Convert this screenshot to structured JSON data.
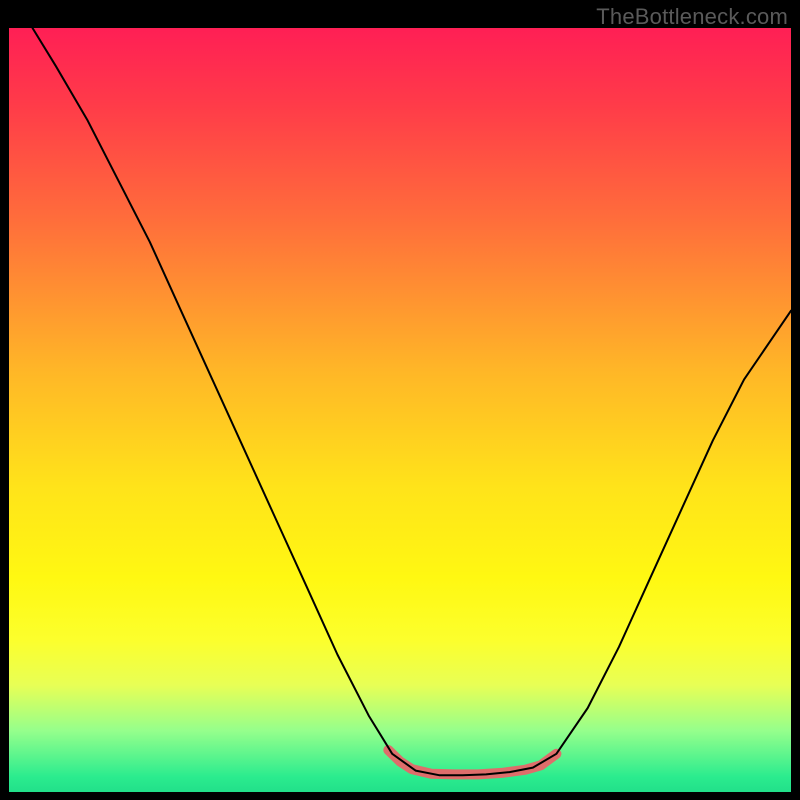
{
  "watermark": "TheBottleneck.com",
  "chart_data": {
    "type": "line",
    "title": "",
    "xlabel": "",
    "ylabel": "",
    "xlim": [
      0,
      100
    ],
    "ylim": [
      0,
      100
    ],
    "grid": false,
    "legend": false,
    "background_gradient": {
      "stops": [
        {
          "offset": 0.0,
          "color": "#ff1f55"
        },
        {
          "offset": 0.1,
          "color": "#ff3b49"
        },
        {
          "offset": 0.25,
          "color": "#ff6d3b"
        },
        {
          "offset": 0.45,
          "color": "#ffb727"
        },
        {
          "offset": 0.6,
          "color": "#ffe31a"
        },
        {
          "offset": 0.72,
          "color": "#fff812"
        },
        {
          "offset": 0.8,
          "color": "#fcff2c"
        },
        {
          "offset": 0.86,
          "color": "#e8ff55"
        },
        {
          "offset": 0.92,
          "color": "#95ff8c"
        },
        {
          "offset": 0.98,
          "color": "#2bec8e"
        },
        {
          "offset": 1.0,
          "color": "#22e08a"
        }
      ]
    },
    "curve": {
      "color": "#000000",
      "width": 2,
      "points": [
        {
          "x": 3,
          "y": 100
        },
        {
          "x": 6,
          "y": 95
        },
        {
          "x": 10,
          "y": 88
        },
        {
          "x": 14,
          "y": 80
        },
        {
          "x": 18,
          "y": 72
        },
        {
          "x": 22,
          "y": 63
        },
        {
          "x": 26,
          "y": 54
        },
        {
          "x": 30,
          "y": 45
        },
        {
          "x": 34,
          "y": 36
        },
        {
          "x": 38,
          "y": 27
        },
        {
          "x": 42,
          "y": 18
        },
        {
          "x": 46,
          "y": 10
        },
        {
          "x": 49,
          "y": 5
        },
        {
          "x": 52,
          "y": 2.8
        },
        {
          "x": 55,
          "y": 2.2
        },
        {
          "x": 58,
          "y": 2.2
        },
        {
          "x": 61,
          "y": 2.3
        },
        {
          "x": 64,
          "y": 2.6
        },
        {
          "x": 67,
          "y": 3.2
        },
        {
          "x": 70,
          "y": 5
        },
        {
          "x": 74,
          "y": 11
        },
        {
          "x": 78,
          "y": 19
        },
        {
          "x": 82,
          "y": 28
        },
        {
          "x": 86,
          "y": 37
        },
        {
          "x": 90,
          "y": 46
        },
        {
          "x": 94,
          "y": 54
        },
        {
          "x": 98,
          "y": 60
        },
        {
          "x": 100,
          "y": 63
        }
      ]
    },
    "highlight_segment": {
      "color": "#de6d6b",
      "width": 10,
      "points": [
        {
          "x": 48.5,
          "y": 5.5
        },
        {
          "x": 50.0,
          "y": 4.0
        },
        {
          "x": 51.5,
          "y": 3.0
        },
        {
          "x": 54,
          "y": 2.4
        },
        {
          "x": 57,
          "y": 2.3
        },
        {
          "x": 60,
          "y": 2.3
        },
        {
          "x": 63,
          "y": 2.5
        },
        {
          "x": 66,
          "y": 2.9
        },
        {
          "x": 68,
          "y": 3.5
        },
        {
          "x": 70,
          "y": 5.0
        }
      ]
    }
  }
}
